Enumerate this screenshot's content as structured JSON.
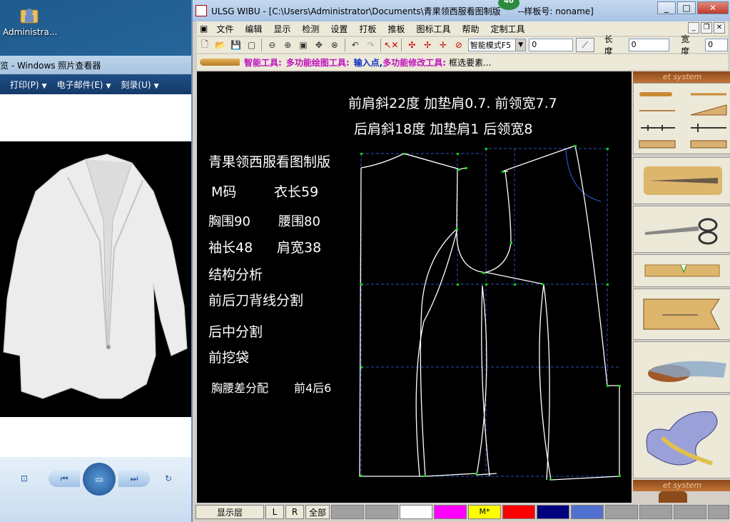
{
  "desktop": {
    "icon_label": "Administra..."
  },
  "viewer": {
    "title": "览 - Windows 照片查看器",
    "menu": [
      {
        "label": "打印(P)"
      },
      {
        "label": "电子邮件(E)"
      },
      {
        "label": "刻录(U)"
      }
    ]
  },
  "main": {
    "title": "ULSG WIBU - [C:\\Users\\Administrator\\Documents\\青果领西服看图制版",
    "title_suffix": "--样板号: noname]",
    "badge": "40",
    "menu": [
      "文件",
      "编辑",
      "显示",
      "检测",
      "设置",
      "打板",
      "推板",
      "图标工具",
      "帮助",
      "定制工具"
    ],
    "toolbar": {
      "mode_select": "智能模式F5",
      "value_field": "0",
      "length_label": "长度",
      "length_value": "0",
      "width_label": "宽度",
      "width_value": "0"
    },
    "smartbar": {
      "label1": "智能工具:",
      "label2": "多功能绘图工具:",
      "label3": "输入点,",
      "label4": "多功能修改工具:",
      "label5": "框选要素..."
    },
    "canvas_notes": {
      "line1": "前肩斜22度   加垫肩0.7.   前领宽7.7",
      "line2": "后肩斜18度   加垫肩1    后领宽8",
      "title": "青果领西服看图制版",
      "size": "M码",
      "length": "衣长59",
      "bust": "胸围90",
      "waist": "腰围80",
      "sleeve": "袖长48",
      "shoulder": "肩宽38",
      "analysis": "结构分析",
      "seam1": "前后刀背线分割",
      "seam2": "后中分割",
      "pocket": "前挖袋",
      "dart": "胸腰差分配",
      "dart_ratio": "前4后6"
    },
    "right_panel": {
      "header": "et system",
      "footer": "et system"
    },
    "status": {
      "layer_button": "显示层",
      "l_button": "L",
      "r_button": "R",
      "all_button": "全部",
      "marker": "M*"
    },
    "swatch_colors": [
      "#a0a0a0",
      "#a0a0a0",
      "#ffffff",
      "#ff00ff",
      "#ffff00",
      "#ff0000",
      "#000080",
      "#5070d0",
      "#a0a0a0",
      "#a0a0a0",
      "#a0a0a0",
      "#a0a0a0"
    ]
  }
}
